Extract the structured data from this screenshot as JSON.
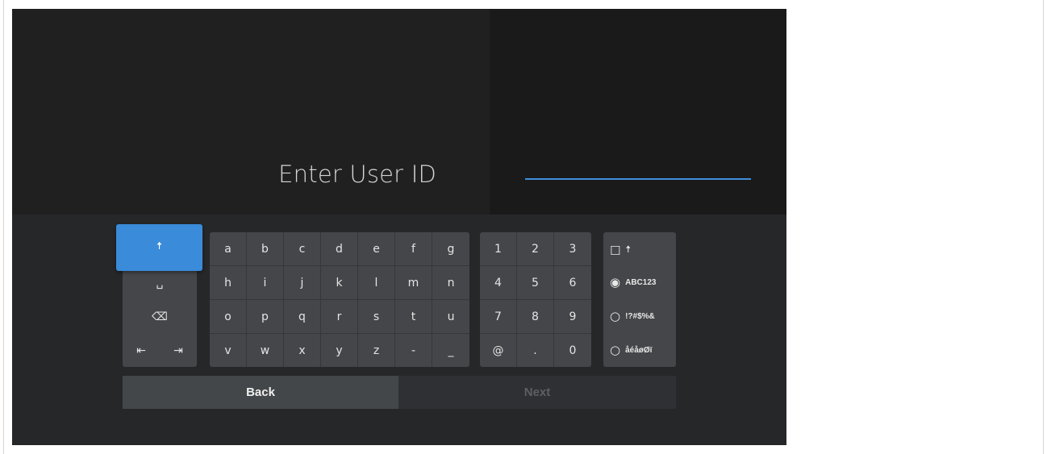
{
  "prompt": {
    "title": "Enter User ID"
  },
  "input": {
    "value": ""
  },
  "keyboard": {
    "shift_glyph": "🠅",
    "space_glyph": "␣",
    "backspace_glyph": "⌫",
    "cursor_left_glyph": "⇤",
    "cursor_right_glyph": "⇥",
    "letters": [
      [
        "a",
        "b",
        "c",
        "d",
        "e",
        "f",
        "g"
      ],
      [
        "h",
        "i",
        "j",
        "k",
        "l",
        "m",
        "n"
      ],
      [
        "o",
        "p",
        "q",
        "r",
        "s",
        "t",
        "u"
      ],
      [
        "v",
        "w",
        "x",
        "y",
        "z",
        "-",
        "_"
      ]
    ],
    "numbers": [
      [
        "1",
        "2",
        "3"
      ],
      [
        "4",
        "5",
        "6"
      ],
      [
        "7",
        "8",
        "9"
      ],
      [
        "@",
        ".",
        "0"
      ]
    ],
    "modes": {
      "caps_lock_glyph": "☐",
      "caps_shift_glyph": "🠅",
      "selected_radio_glyph": "◉",
      "radio_glyph": "○",
      "options": [
        "ABC123",
        "!?#$%&",
        "åéåøØï"
      ]
    }
  },
  "buttons": {
    "back_label": "Back",
    "next_label": "Next"
  },
  "colors": {
    "accent": "#3a8bd9",
    "field_underline": "#3f8fde",
    "key_background": "#444649",
    "background": "#262729"
  }
}
